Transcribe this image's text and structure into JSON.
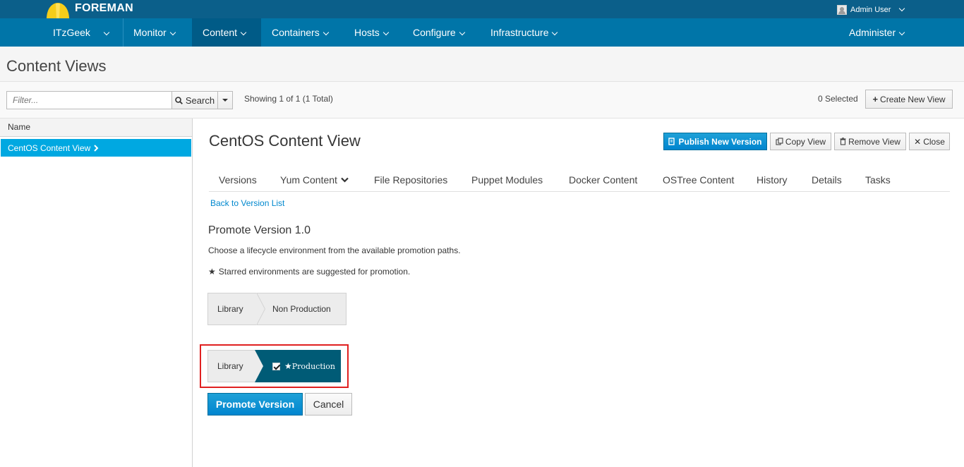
{
  "app": {
    "brand": "FOREMAN",
    "user": "Admin User"
  },
  "nav": {
    "org": "ITzGeek",
    "items": [
      "Monitor",
      "Content",
      "Containers",
      "Hosts",
      "Configure",
      "Infrastructure"
    ],
    "active": "Content",
    "administer": "Administer"
  },
  "page": {
    "title": "Content Views"
  },
  "toolbar": {
    "filter_placeholder": "Filter...",
    "search_label": "Search",
    "showing": "Showing 1 of 1 (1 Total)",
    "selected": "0 Selected",
    "create_label": "Create New View"
  },
  "list": {
    "header": "Name",
    "rows": [
      "CentOS Content View"
    ]
  },
  "detail": {
    "title": "CentOS Content View",
    "publish_label": "Publish New Version",
    "copy_label": "Copy View",
    "remove_label": "Remove View",
    "close_label": "Close",
    "tabs": [
      "Versions",
      "Yum Content",
      "File Repositories",
      "Puppet Modules",
      "Docker Content",
      "OSTree Content",
      "History",
      "Details",
      "Tasks"
    ],
    "back_link": "Back to Version List",
    "promote_title": "Promote Version 1.0",
    "help_text": "Choose a lifecycle environment from the available promotion paths.",
    "starred_text": "Starred environments are suggested for promotion.",
    "path1": [
      "Library",
      "Non Production"
    ],
    "path2": [
      "Library",
      "Production"
    ],
    "promote_button": "Promote Version",
    "cancel_button": "Cancel"
  },
  "colors": {
    "topbar": "#0b5f8a",
    "navbar": "#0075a8",
    "accent": "#00a8e1",
    "selected_env": "#005b76",
    "highlight": "#e02020"
  }
}
